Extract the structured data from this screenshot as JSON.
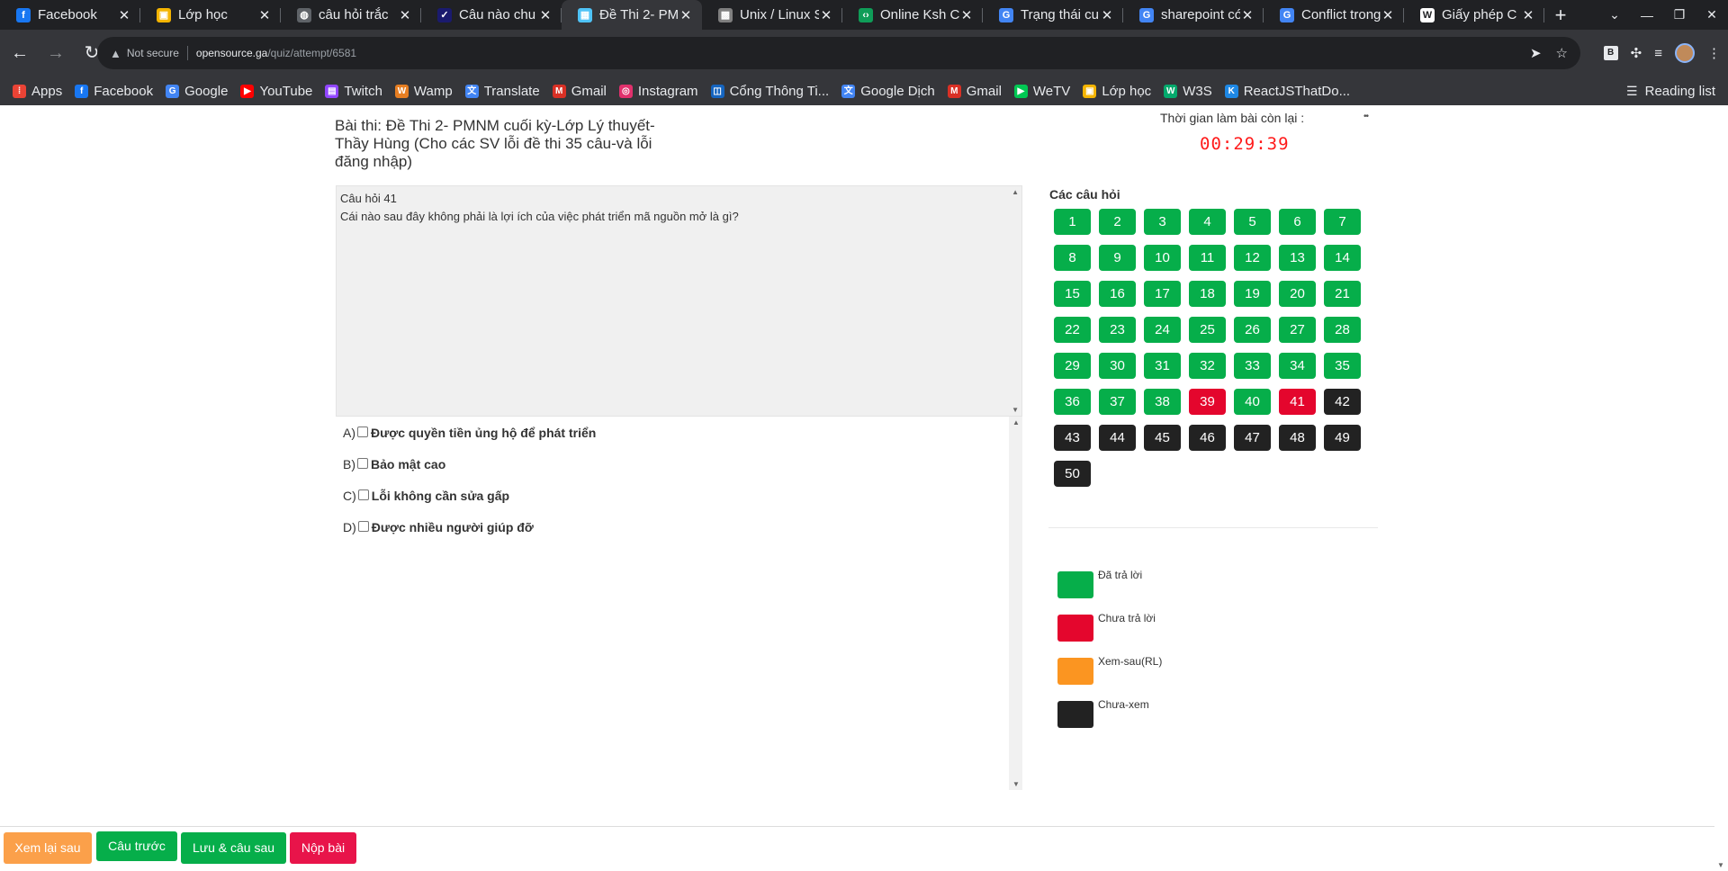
{
  "browser": {
    "tabs": [
      {
        "title": "Facebook",
        "icon_color": "#1877f2",
        "icon_glyph": "f"
      },
      {
        "title": "Lớp học",
        "icon_color": "#f4b400",
        "icon_glyph": "▣"
      },
      {
        "title": "câu hỏi trắc",
        "icon_color": "#5f6368",
        "icon_glyph": "◍"
      },
      {
        "title": "Câu nào chu",
        "icon_color": "#1a1a6e",
        "icon_glyph": "✓"
      },
      {
        "title": "Đề Thi 2- PM",
        "icon_color": "#4fc3f7",
        "icon_glyph": "▦"
      },
      {
        "title": "Unix / Linux S",
        "icon_color": "#7f7f7f",
        "icon_glyph": "▩"
      },
      {
        "title": "Online Ksh C",
        "icon_color": "#0f9d58",
        "icon_glyph": "‹›"
      },
      {
        "title": "Trạng thái cu",
        "icon_color": "#4285f4",
        "icon_glyph": "G"
      },
      {
        "title": "sharepoint có",
        "icon_color": "#4285f4",
        "icon_glyph": "G"
      },
      {
        "title": "Conflict trong",
        "icon_color": "#4285f4",
        "icon_glyph": "G"
      },
      {
        "title": "Giấy phép C",
        "icon_color": "#ffffff",
        "icon_glyph": "W"
      }
    ],
    "active_tab": 4,
    "address": {
      "security": "Not secure",
      "host": "opensource.ga",
      "path": "/quiz/attempt/6581"
    },
    "bookmarks": [
      {
        "label": "Apps",
        "icon_color": "#ea4335",
        "icon_glyph": "⁞"
      },
      {
        "label": "Facebook",
        "icon_color": "#1877f2",
        "icon_glyph": "f"
      },
      {
        "label": "Google",
        "icon_color": "#4285f4",
        "icon_glyph": "G"
      },
      {
        "label": "YouTube",
        "icon_color": "#ff0000",
        "icon_glyph": "▶"
      },
      {
        "label": "Twitch",
        "icon_color": "#9146ff",
        "icon_glyph": "▤"
      },
      {
        "label": "Wamp",
        "icon_color": "#e67e22",
        "icon_glyph": "W"
      },
      {
        "label": "Translate",
        "icon_color": "#4285f4",
        "icon_glyph": "文"
      },
      {
        "label": "Gmail",
        "icon_color": "#d93025",
        "icon_glyph": "M"
      },
      {
        "label": "Instagram",
        "icon_color": "#e1306c",
        "icon_glyph": "◎"
      },
      {
        "label": "Cổng Thông Ti...",
        "icon_color": "#1565c0",
        "icon_glyph": "◫"
      },
      {
        "label": "Google Dịch",
        "icon_color": "#4285f4",
        "icon_glyph": "文"
      },
      {
        "label": "Gmail",
        "icon_color": "#d93025",
        "icon_glyph": "M"
      },
      {
        "label": "WeTV",
        "icon_color": "#00c853",
        "icon_glyph": "▶"
      },
      {
        "label": "Lớp học",
        "icon_color": "#f4b400",
        "icon_glyph": "▣"
      },
      {
        "label": "W3S",
        "icon_color": "#04aa6d",
        "icon_glyph": "W"
      },
      {
        "label": "ReactJSThatDo...",
        "icon_color": "#1e88e5",
        "icon_glyph": "K"
      }
    ],
    "reading_list": "Reading list"
  },
  "exam": {
    "title": "Bài thi: Đề Thi 2- PMNM cuối kỳ-Lớp Lý thuyết-Thầy Hùng (Cho các SV lỗi đề thi 35 câu-và lỗi đăng nhập)",
    "timer_label": "Thời gian làm bài còn lại :",
    "timer_value": "00:29:39",
    "timer_dots": "••"
  },
  "question": {
    "number_label": "Câu hỏi 41",
    "text": "Cái nào sau đây không phải là lợi ích của việc phát triển mã nguồn mở là gì?",
    "answers": [
      {
        "letter": "A)",
        "text": "Được quyền tiền ủng hộ để phát triển",
        "checked": false
      },
      {
        "letter": "B)",
        "text": "Bảo mật cao",
        "checked": false
      },
      {
        "letter": "C)",
        "text": "Lỗi không cần sửa gấp",
        "checked": false
      },
      {
        "letter": "D)",
        "text": "Được nhiều người giúp đỡ",
        "checked": false
      }
    ]
  },
  "navigator": {
    "title": "Các câu hỏi",
    "questions": [
      {
        "n": "1",
        "status": "answered"
      },
      {
        "n": "2",
        "status": "answered"
      },
      {
        "n": "3",
        "status": "answered"
      },
      {
        "n": "4",
        "status": "answered"
      },
      {
        "n": "5",
        "status": "answered"
      },
      {
        "n": "6",
        "status": "answered"
      },
      {
        "n": "7",
        "status": "answered"
      },
      {
        "n": "8",
        "status": "answered"
      },
      {
        "n": "9",
        "status": "answered"
      },
      {
        "n": "10",
        "status": "answered"
      },
      {
        "n": "11",
        "status": "answered"
      },
      {
        "n": "12",
        "status": "answered"
      },
      {
        "n": "13",
        "status": "answered"
      },
      {
        "n": "14",
        "status": "answered"
      },
      {
        "n": "15",
        "status": "answered"
      },
      {
        "n": "16",
        "status": "answered"
      },
      {
        "n": "17",
        "status": "answered"
      },
      {
        "n": "18",
        "status": "answered"
      },
      {
        "n": "19",
        "status": "answered"
      },
      {
        "n": "20",
        "status": "answered"
      },
      {
        "n": "21",
        "status": "answered"
      },
      {
        "n": "22",
        "status": "answered"
      },
      {
        "n": "23",
        "status": "answered"
      },
      {
        "n": "24",
        "status": "answered"
      },
      {
        "n": "25",
        "status": "answered"
      },
      {
        "n": "26",
        "status": "answered"
      },
      {
        "n": "27",
        "status": "answered"
      },
      {
        "n": "28",
        "status": "answered"
      },
      {
        "n": "29",
        "status": "answered"
      },
      {
        "n": "30",
        "status": "answered"
      },
      {
        "n": "31",
        "status": "answered"
      },
      {
        "n": "32",
        "status": "answered"
      },
      {
        "n": "33",
        "status": "answered"
      },
      {
        "n": "34",
        "status": "answered"
      },
      {
        "n": "35",
        "status": "answered"
      },
      {
        "n": "36",
        "status": "answered"
      },
      {
        "n": "37",
        "status": "answered"
      },
      {
        "n": "38",
        "status": "answered"
      },
      {
        "n": "39",
        "status": "unanswered"
      },
      {
        "n": "40",
        "status": "answered"
      },
      {
        "n": "41",
        "status": "unanswered"
      },
      {
        "n": "42",
        "status": "unseen"
      },
      {
        "n": "43",
        "status": "unseen"
      },
      {
        "n": "44",
        "status": "unseen"
      },
      {
        "n": "45",
        "status": "unseen"
      },
      {
        "n": "46",
        "status": "unseen"
      },
      {
        "n": "47",
        "status": "unseen"
      },
      {
        "n": "48",
        "status": "unseen"
      },
      {
        "n": "49",
        "status": "unseen"
      },
      {
        "n": "50",
        "status": "unseen"
      }
    ]
  },
  "legend": [
    {
      "label": "Đã trả lời",
      "color": "#06ae4a"
    },
    {
      "label": "Chưa trả lời",
      "color": "#e4062d"
    },
    {
      "label": "Xem-sau(RL)",
      "color": "#fb9521"
    },
    {
      "label": "Chưa-xem",
      "color": "#222222"
    }
  ],
  "footer": {
    "review_later": {
      "label": "Xem lại sau",
      "color": "#fba04a"
    },
    "previous": {
      "label": "Câu trước",
      "color": "#06ae4a"
    },
    "save_next": {
      "label": "Lưu & câu sau",
      "color": "#06ae4a"
    },
    "submit": {
      "label": "Nộp bài",
      "color": "#e8144a"
    }
  }
}
